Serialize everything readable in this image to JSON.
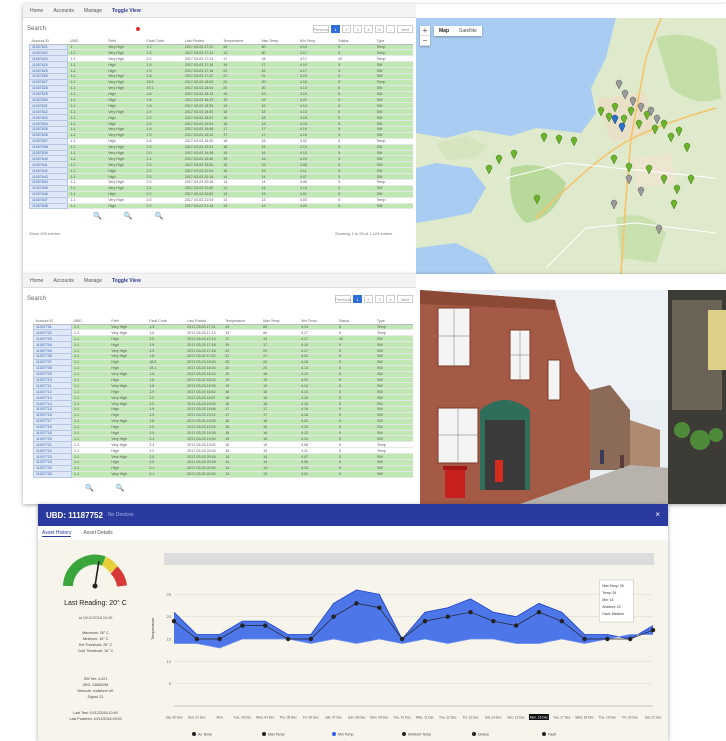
{
  "panel_a": {
    "nav": [
      "Home",
      "Accounts",
      "Manage",
      "Toggle View"
    ],
    "search_label": "Search",
    "pager": [
      "Previous",
      "1",
      "2",
      "3",
      "4",
      "5",
      "...",
      "Next"
    ],
    "columns": [
      "Account ID",
      "UBID",
      "Field",
      "Fault Code",
      "Last Posted",
      "Temperature",
      "Max Temp",
      "Min Temp",
      "Status",
      "Type"
    ],
    "rows": [
      {
        "c": "g",
        "cells": [
          "11007621",
          "1",
          "Very High",
          "1.3",
          "2017-03-03 17:11",
          "43",
          "60",
          "4.13",
          "5",
          "Temp"
        ]
      },
      {
        "c": "g",
        "cells": [
          "11007622",
          "1-1",
          "Very High",
          "1.5",
          "2017-03-03 17:14",
          "13",
          "60",
          "4.17",
          "5",
          "Temp"
        ]
      },
      {
        "c": "w",
        "cells": [
          "11007623",
          "1-1",
          "Very High",
          "2.0",
          "2017-03-03 17:14",
          "17",
          "44",
          "4.17",
          "40",
          "Temp"
        ]
      },
      {
        "c": "g",
        "cells": [
          "11007624",
          "1-1",
          "High",
          "1.9",
          "2017-03-03 17:18",
          "19",
          "17",
          "4.10",
          "5",
          "SW"
        ]
      },
      {
        "c": "g",
        "cells": [
          "11007625",
          "1-1",
          "High",
          "1.9",
          "2017-03-03 17:18",
          "22",
          "22",
          "4.17",
          "5",
          "SW"
        ]
      },
      {
        "c": "g",
        "cells": [
          "11007626",
          "1-1",
          "Very High",
          "1.8",
          "2017-03-03 17:22",
          "21",
          "21",
          "4.24",
          "5",
          "SW"
        ]
      },
      {
        "c": "g",
        "cells": [
          "11007627",
          "1-1",
          "Very High",
          "18.5",
          "2017-03-03 18:00",
          "20",
          "20",
          "4.16",
          "5",
          "Temp"
        ]
      },
      {
        "c": "g",
        "cells": [
          "11007628",
          "1-1",
          "Very High",
          "19.1",
          "2017-03-03 18:04",
          "20",
          "20",
          "4.13",
          "5",
          "SW"
        ]
      },
      {
        "c": "g",
        "cells": [
          "11007629",
          "1-1",
          "High",
          "1.6",
          "2017-03-03 18:13",
          "19",
          "19",
          "4.19",
          "5",
          "SW"
        ]
      },
      {
        "c": "g",
        "cells": [
          "11007630",
          "1-1",
          "High",
          "1.6",
          "2017-03-03 18:23",
          "19",
          "19",
          "4.22",
          "5",
          "SW"
        ]
      },
      {
        "c": "g",
        "cells": [
          "11007631",
          "1-1",
          "High",
          "1.8",
          "2017-03-03 18:35",
          "19",
          "19",
          "4.14",
          "5",
          "SW"
        ]
      },
      {
        "c": "g",
        "cells": [
          "11007632",
          "1-1",
          "Very High",
          "1.9",
          "2017-03-03 18:52",
          "18",
          "18",
          "4.13",
          "5",
          "SW"
        ]
      },
      {
        "c": "g",
        "cells": [
          "11007633",
          "1-1",
          "High",
          "2.0",
          "2017-03-03 18:57",
          "18",
          "18",
          "4.18",
          "5",
          "SW"
        ]
      },
      {
        "c": "g",
        "cells": [
          "11007634",
          "1-1",
          "High",
          "2.0",
          "2017-03-03 19:04",
          "18",
          "18",
          "4.15",
          "5",
          "SW"
        ]
      },
      {
        "c": "g",
        "cells": [
          "11007635",
          "1-1",
          "Very High",
          "1.9",
          "2017-03-03 19:08",
          "17",
          "17",
          "4.19",
          "5",
          "SW"
        ]
      },
      {
        "c": "g",
        "cells": [
          "11007636",
          "1-1",
          "Very High",
          "1.9",
          "2017-03-03 19:12",
          "17",
          "17",
          "4.16",
          "5",
          "SW"
        ]
      },
      {
        "c": "w",
        "cells": [
          "11007637",
          "1-1",
          "High",
          "1.8",
          "2017-03-03 19:20",
          "16",
          "16",
          "4.02",
          "5",
          "Temp"
        ]
      },
      {
        "c": "g",
        "cells": [
          "11007638",
          "1-1",
          "Very High",
          "2.0",
          "2017-03-03 19:24",
          "16",
          "16",
          "4.14",
          "5",
          "SW"
        ]
      },
      {
        "c": "g",
        "cells": [
          "11007639",
          "1-1",
          "Very High",
          "2.0",
          "2017-03-03 19:28",
          "16",
          "16",
          "4.13",
          "5",
          "SW"
        ]
      },
      {
        "c": "g",
        "cells": [
          "11007640",
          "1-1",
          "Very High",
          "2.1",
          "2017-03-03 19:40",
          "15",
          "15",
          "4.10",
          "5",
          "SW"
        ]
      },
      {
        "c": "g",
        "cells": [
          "11007641",
          "1-1",
          "Very High",
          "2.3",
          "2017-03-03 19:52",
          "15",
          "15",
          "4.08",
          "5",
          "SW"
        ]
      },
      {
        "c": "g",
        "cells": [
          "11007642",
          "1-1",
          "High",
          "2.2",
          "2017-03-03 20:04",
          "15",
          "15",
          "4.11",
          "5",
          "SW"
        ]
      },
      {
        "c": "g",
        "cells": [
          "11007643",
          "1-1",
          "High",
          "2.5",
          "2017-03-03 20:16",
          "14",
          "14",
          "4.07",
          "5",
          "SW"
        ]
      },
      {
        "c": "w",
        "cells": [
          "11007644",
          "1-1",
          "Very High",
          "2.0",
          "2017-03-03 20:28",
          "14",
          "14",
          "4.06",
          "5",
          "Temp"
        ]
      },
      {
        "c": "g",
        "cells": [
          "11007645",
          "1-1",
          "Very High",
          "2.1",
          "2017-03-03 20:40",
          "14",
          "14",
          "4.10",
          "5",
          "SW"
        ]
      },
      {
        "c": "g",
        "cells": [
          "11007646",
          "1-1",
          "High",
          "2.1",
          "2017-03-03 20:52",
          "13",
          "13",
          "4.01",
          "5",
          "SW"
        ]
      },
      {
        "c": "w",
        "cells": [
          "11007647",
          "1-1",
          "Very High",
          "2.0",
          "2017-03-03 21:04",
          "13",
          "13",
          "4.03",
          "5",
          "Temp"
        ]
      },
      {
        "c": "g",
        "cells": [
          "11007648",
          "1-1",
          "High",
          "2.2",
          "2017-03-03 21:16",
          "13",
          "13",
          "4.00",
          "5",
          "SW"
        ]
      }
    ],
    "footer_left": "Show 100 entries",
    "footer_right": "Showing 1 to 28 of 1,124 entries",
    "map_tabs": [
      "Map",
      "Satellite"
    ],
    "zoom_in": "+",
    "zoom_out": "−"
  },
  "panel_b": {
    "nav": [
      "Home",
      "Accounts",
      "Manage",
      "Toggle View"
    ],
    "search_label": "Search",
    "pager": [
      "Previous",
      "1",
      "2",
      "3",
      "4",
      "Next"
    ],
    "columns": [
      "Account ID",
      "UBID",
      "Field",
      "Fault Code",
      "Last Posted",
      "Temperature",
      "Max Temp",
      "Min Temp",
      "Status",
      "Type"
    ],
    "rows": [
      {
        "c": "g",
        "cells": [
          "11007701",
          "1-1",
          "Very High",
          "1.3",
          "2017-03-03 17:11",
          "43",
          "60",
          "4.13",
          "5",
          "Temp"
        ]
      },
      {
        "c": "w",
        "cells": [
          "11007702",
          "1-1",
          "Very High",
          "1.5",
          "2017-03-03 17:14",
          "13",
          "60",
          "4.17",
          "5",
          "Temp"
        ]
      },
      {
        "c": "g",
        "cells": [
          "11007703",
          "1-1",
          "High",
          "2.0",
          "2017-03-03 17:14",
          "17",
          "44",
          "4.17",
          "40",
          "SW"
        ]
      },
      {
        "c": "g",
        "cells": [
          "11007704",
          "1-1",
          "High",
          "1.9",
          "2017-03-03 17:18",
          "19",
          "17",
          "4.10",
          "5",
          "SW"
        ]
      },
      {
        "c": "g",
        "cells": [
          "11007705",
          "1-1",
          "Very High",
          "1.9",
          "2017-03-03 17:18",
          "22",
          "22",
          "4.17",
          "5",
          "SW"
        ]
      },
      {
        "c": "g",
        "cells": [
          "11007706",
          "1-1",
          "Very High",
          "1.8",
          "2017-03-03 17:22",
          "21",
          "21",
          "4.24",
          "5",
          "SW"
        ]
      },
      {
        "c": "g",
        "cells": [
          "11007707",
          "1-1",
          "High",
          "18.5",
          "2017-03-03 18:00",
          "20",
          "20",
          "4.16",
          "5",
          "SW"
        ]
      },
      {
        "c": "g",
        "cells": [
          "11007708",
          "1-1",
          "High",
          "19.1",
          "2017-03-03 18:04",
          "20",
          "20",
          "4.13",
          "5",
          "SW"
        ]
      },
      {
        "c": "g",
        "cells": [
          "11007709",
          "1-1",
          "Very High",
          "1.6",
          "2017-03-03 18:13",
          "19",
          "19",
          "4.19",
          "5",
          "SW"
        ]
      },
      {
        "c": "g",
        "cells": [
          "11007710",
          "1-1",
          "High",
          "1.6",
          "2017-03-03 18:23",
          "19",
          "19",
          "4.22",
          "5",
          "SW"
        ]
      },
      {
        "c": "g",
        "cells": [
          "11007711",
          "1-1",
          "Very High",
          "1.8",
          "2017-03-03 18:35",
          "19",
          "19",
          "4.14",
          "5",
          "SW"
        ]
      },
      {
        "c": "g",
        "cells": [
          "11007712",
          "1-1",
          "High",
          "1.9",
          "2017-03-03 18:52",
          "18",
          "18",
          "4.13",
          "5",
          "SW"
        ]
      },
      {
        "c": "g",
        "cells": [
          "11007713",
          "1-1",
          "Very High",
          "2.0",
          "2017-03-03 18:57",
          "18",
          "18",
          "4.18",
          "5",
          "SW"
        ]
      },
      {
        "c": "g",
        "cells": [
          "11007714",
          "1-1",
          "Very High",
          "2.0",
          "2017-03-03 19:04",
          "18",
          "18",
          "4.15",
          "5",
          "SW"
        ]
      },
      {
        "c": "g",
        "cells": [
          "11007715",
          "1-1",
          "High",
          "1.9",
          "2017-03-03 19:08",
          "17",
          "17",
          "4.19",
          "5",
          "SW"
        ]
      },
      {
        "c": "g",
        "cells": [
          "11007716",
          "1-1",
          "High",
          "1.9",
          "2017-03-03 19:12",
          "17",
          "17",
          "4.16",
          "5",
          "SW"
        ]
      },
      {
        "c": "g",
        "cells": [
          "11007717",
          "1-1",
          "Very High",
          "1.8",
          "2017-03-03 19:20",
          "16",
          "16",
          "4.02",
          "5",
          "SW"
        ]
      },
      {
        "c": "g",
        "cells": [
          "11007718",
          "1-1",
          "High",
          "2.0",
          "2017-03-03 19:24",
          "16",
          "16",
          "4.14",
          "5",
          "SW"
        ]
      },
      {
        "c": "g",
        "cells": [
          "11007719",
          "1-1",
          "High",
          "2.0",
          "2017-03-03 19:28",
          "16",
          "16",
          "4.13",
          "5",
          "SW"
        ]
      },
      {
        "c": "g",
        "cells": [
          "11007720",
          "1-1",
          "Very High",
          "2.1",
          "2017-03-03 19:40",
          "15",
          "15",
          "4.10",
          "5",
          "SW"
        ]
      },
      {
        "c": "w",
        "cells": [
          "11007721",
          "1-1",
          "Very High",
          "2.3",
          "2017-03-03 19:52",
          "15",
          "15",
          "4.08",
          "5",
          "Temp"
        ]
      },
      {
        "c": "w",
        "cells": [
          "11007722",
          "1-1",
          "High",
          "2.2",
          "2017-03-03 20:04",
          "15",
          "15",
          "4.11",
          "5",
          "Temp"
        ]
      },
      {
        "c": "g",
        "cells": [
          "11007723",
          "1-1",
          "Very High",
          "2.5",
          "2017-03-03 20:16",
          "14",
          "14",
          "4.07",
          "5",
          "SW"
        ]
      },
      {
        "c": "g",
        "cells": [
          "11007724",
          "1-1",
          "High",
          "2.0",
          "2017-03-03 20:28",
          "14",
          "14",
          "4.06",
          "5",
          "SW"
        ]
      },
      {
        "c": "g",
        "cells": [
          "11007725",
          "1-1",
          "High",
          "2.1",
          "2017-03-03 20:40",
          "14",
          "14",
          "4.10",
          "5",
          "SW"
        ]
      },
      {
        "c": "g",
        "cells": [
          "11007726",
          "1-1",
          "Very High",
          "2.1",
          "2017-03-03 20:52",
          "13",
          "13",
          "4.01",
          "5",
          "SW"
        ]
      }
    ]
  },
  "modal": {
    "title": "UBD: 11187752",
    "subtitle": "No Devices",
    "close": "×",
    "tabs": [
      "Asset History",
      "Asset Details"
    ],
    "last_reading": "Last Reading: 20° C",
    "reading_time": "at 10/12/2018 10:49",
    "stats": [
      "Maximum: 26° C",
      "Minimum: 15° C",
      "Hot Threshold: 26° C",
      "Cold Threshold: 16° C"
    ],
    "info": [
      "SW Ver: 4.021",
      "UBC: 24866258",
      "Network: vodafone UK",
      "Signal: 21"
    ],
    "last_dates": [
      "Last Test: 10/12/2018 10:49",
      "Last Powered: 10/12/2018 09:53"
    ],
    "gauge_value": 0.55,
    "colors": {
      "header": "#2b3a9e",
      "band": "#2f5fe8",
      "band_light": "#6f8ff0",
      "gauge_green": "#3aa53a",
      "gauge_yellow": "#e8d03a",
      "gauge_red": "#d83a3a"
    }
  },
  "chart_data": {
    "type": "area",
    "ylabel": "Temperature",
    "ylim": [
      0,
      30
    ],
    "yticks": [
      5,
      10,
      15,
      20,
      25
    ],
    "categories": [
      "Sat, 30 Nov",
      "Sun, 01 Dec",
      "Mon",
      "Tue, 03 Dec",
      "Wed, 04 Dec",
      "Thu, 05 Dec",
      "Fri, 06 Dec",
      "Sat, 07 Dec",
      "Sun, 08 Dec",
      "Mon, 09 Dec",
      "Tue, 10 Dec",
      "Wed, 11 Dec",
      "Thu, 12 Dec",
      "Fri, 13 Dec",
      "Sat, 14 Dec",
      "Sun, 15 Dec",
      "Mon, 16 Dec",
      "Tue, 17 Dec",
      "Wed, 18 Dec",
      "Thu, 19 Dec",
      "Fri, 20 Dec",
      "Sat, 21 Dec"
    ],
    "series": [
      {
        "name": "Max Temp",
        "values": [
          21,
          16,
          16,
          19,
          19,
          16,
          16,
          23,
          26,
          25,
          15,
          21,
          22,
          24,
          21,
          20,
          23,
          21,
          16,
          16,
          15,
          18
        ]
      },
      {
        "name": "Min Temp",
        "values": [
          14,
          14,
          13,
          15,
          15,
          15,
          14,
          15,
          14,
          15,
          14,
          15,
          14,
          15,
          15,
          14,
          14,
          15,
          14,
          15,
          16,
          16
        ]
      },
      {
        "name": "Avg Temp",
        "values": [
          19,
          15,
          15,
          18,
          18,
          15,
          15,
          20,
          23,
          22,
          15,
          19,
          20,
          21,
          19,
          18,
          21,
          19,
          15,
          15,
          15,
          17
        ]
      }
    ],
    "legend": [
      "Ac Temp",
      "Max Temp",
      "Min Temp",
      "Ambient Temp",
      "Device",
      "Fault"
    ],
    "tooltip": [
      "Max Temp: 26",
      "Temp: 26",
      "Min: 15",
      "Ambient: 22",
      "Fault: Medium"
    ],
    "x_highlight": "Mon, 16 Dec"
  }
}
